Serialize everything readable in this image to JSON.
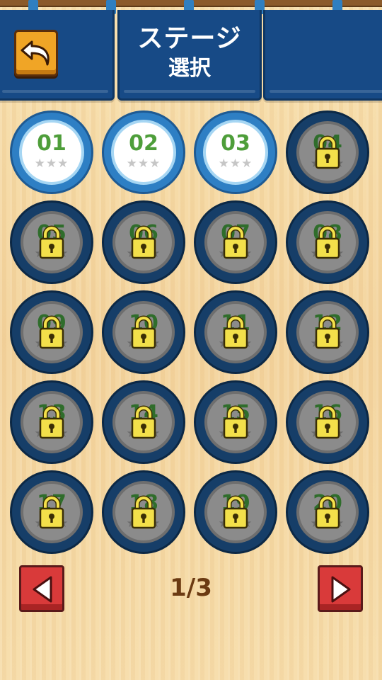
{
  "header": {
    "title_line1": "ステージ",
    "title_line2": "選択"
  },
  "back_button": {
    "icon": "back-arrow-icon"
  },
  "stages": [
    {
      "number": "01",
      "locked": false,
      "stars": 0
    },
    {
      "number": "02",
      "locked": false,
      "stars": 0
    },
    {
      "number": "03",
      "locked": false,
      "stars": 0
    },
    {
      "number": "04",
      "locked": true,
      "stars": 0
    },
    {
      "number": "05",
      "locked": true,
      "stars": 0
    },
    {
      "number": "06",
      "locked": true,
      "stars": 0
    },
    {
      "number": "07",
      "locked": true,
      "stars": 0
    },
    {
      "number": "08",
      "locked": true,
      "stars": 0
    },
    {
      "number": "09",
      "locked": true,
      "stars": 0
    },
    {
      "number": "10",
      "locked": true,
      "stars": 0
    },
    {
      "number": "11",
      "locked": true,
      "stars": 0
    },
    {
      "number": "12",
      "locked": true,
      "stars": 0
    },
    {
      "number": "13",
      "locked": true,
      "stars": 0
    },
    {
      "number": "14",
      "locked": true,
      "stars": 0
    },
    {
      "number": "15",
      "locked": true,
      "stars": 0
    },
    {
      "number": "16",
      "locked": true,
      "stars": 0
    },
    {
      "number": "17",
      "locked": true,
      "stars": 0
    },
    {
      "number": "18",
      "locked": true,
      "stars": 0
    },
    {
      "number": "19",
      "locked": true,
      "stars": 0
    },
    {
      "number": "20",
      "locked": true,
      "stars": 0
    }
  ],
  "star_glyphs": "★★★",
  "pager": {
    "label": "1/3",
    "prev_icon": "left-triangle-icon",
    "next_icon": "right-triangle-icon"
  },
  "colors": {
    "banner": "#174a86",
    "open_stage": "#2e7fc4",
    "locked_stage": "#163e68",
    "lock": "#f3e04a",
    "number": "#4e9e3a",
    "pager_button": "#d93a3a",
    "back_button": "#f0a526"
  }
}
